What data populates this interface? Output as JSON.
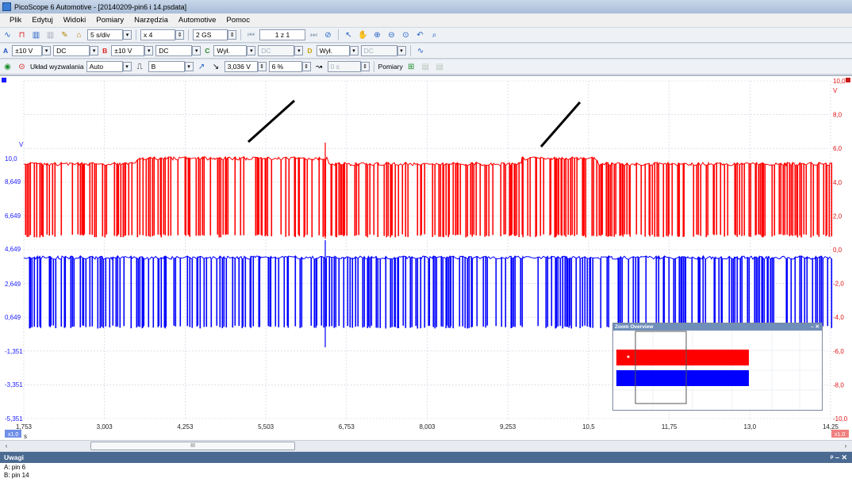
{
  "window": {
    "title": "PicoScope 6 Automotive - [20140209-pin6 i 14.psdata]"
  },
  "menu": [
    "Plik",
    "Edytuj",
    "Widoki",
    "Pomiary",
    "Narzędzia",
    "Automotive",
    "Pomoc"
  ],
  "toolbar1": {
    "timebase": "5 s/div",
    "zoom": "x 4",
    "samples": "2 GS",
    "page": "1 z 1"
  },
  "toolbar2": {
    "A": {
      "label": "A",
      "range": "±10 V",
      "coupling": "DC"
    },
    "B": {
      "label": "B",
      "range": "±10 V",
      "coupling": "DC"
    },
    "C": {
      "label": "C",
      "range": "Wył.",
      "coupling": "DC"
    },
    "D": {
      "label": "D",
      "range": "Wył.",
      "coupling": "DC"
    }
  },
  "toolbar3": {
    "trigger_label": "Układ wyzwalania",
    "trigger_mode": "Auto",
    "trigger_source": "B",
    "threshold": "3,036 V",
    "pretrigger": "6 %",
    "delay": "0 s",
    "measurements_label": "Pomiary"
  },
  "axes": {
    "left_unit": "V",
    "left_ticks": [
      "10,0",
      "8,649",
      "6,649",
      "4,649",
      "2,649",
      "0,649",
      "-1,351",
      "-3,351",
      "-5,351"
    ],
    "right_unit": "V",
    "right_ticks": [
      "10,0",
      "8,0",
      "6,0",
      "4,0",
      "2,0",
      "0,0",
      "-2,0",
      "-4,0",
      "-6,0",
      "-8,0",
      "-10,0"
    ],
    "x_ticks": [
      "1,753",
      "3,003",
      "4,253",
      "5,503",
      "6,753",
      "8,003",
      "9,253",
      "10,5",
      "11,75",
      "13,0",
      "14,25"
    ],
    "x_unit": "s",
    "left_badge": "x1.0",
    "right_badge": "x1.0"
  },
  "colors": {
    "channel_a": "#1a1aff",
    "channel_b": "#ff1a1a",
    "grid": "#c8d0dc"
  },
  "zoom_overview": {
    "title": "Zoom Overview"
  },
  "notes": {
    "title": "Uwagi",
    "lines": [
      "A: pin 6",
      "B: pin 14"
    ]
  },
  "scrollbar": {
    "thumb_text": "III"
  }
}
